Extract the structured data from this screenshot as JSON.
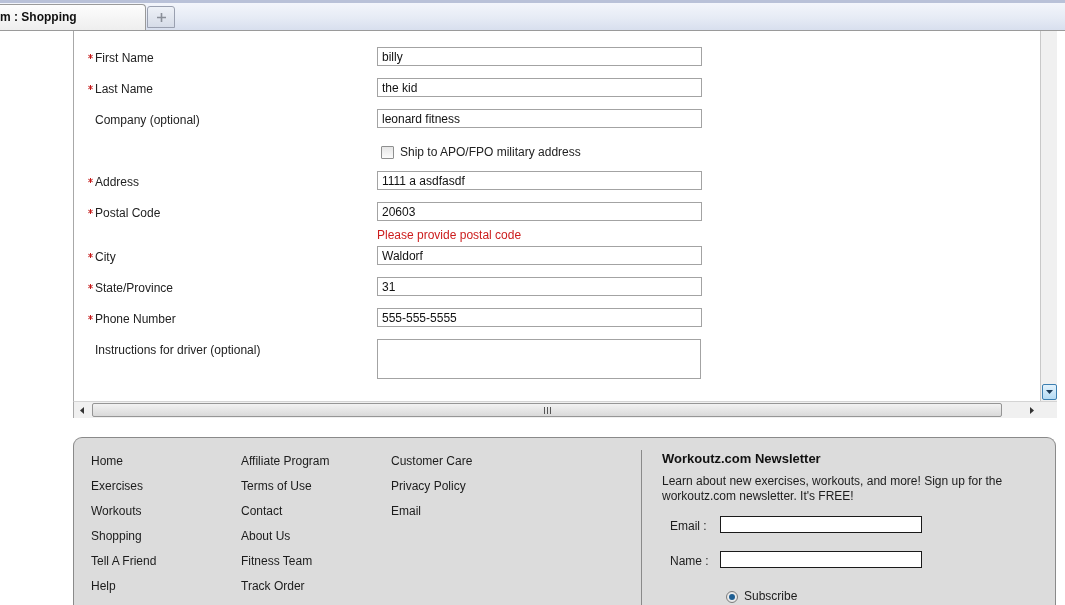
{
  "tabs": [
    {
      "title": "m : Shopping",
      "selected": true
    }
  ],
  "form": {
    "fields": [
      {
        "kind": "text",
        "label": "First Name",
        "required": true,
        "value": "billy"
      },
      {
        "kind": "text",
        "label": "Last Name",
        "required": true,
        "value": "the kid"
      },
      {
        "kind": "text",
        "label": "Company (optional)",
        "required": false,
        "value": "leonard fitness"
      },
      {
        "kind": "checkbox",
        "label": "Ship to APO/FPO military address",
        "checked": false
      },
      {
        "kind": "text",
        "label": "Address",
        "required": true,
        "value": "1111 a asdfasdf"
      },
      {
        "kind": "text",
        "label": "Postal Code",
        "required": true,
        "value": "20603",
        "error": "Please provide postal code"
      },
      {
        "kind": "text",
        "label": "City",
        "required": true,
        "value": "Waldorf"
      },
      {
        "kind": "text",
        "label": "State/Province",
        "required": true,
        "value": "31"
      },
      {
        "kind": "text",
        "label": "Phone Number",
        "required": true,
        "value": "555-555-5555"
      },
      {
        "kind": "textarea",
        "label": "Instructions for driver (optional)",
        "required": false
      }
    ]
  },
  "footer": {
    "link_columns": [
      [
        "Home",
        "Exercises",
        "Workouts",
        "Shopping",
        "Tell A Friend",
        "Help"
      ],
      [
        "Affiliate Program",
        "Terms of Use",
        "Contact",
        "About Us",
        "Fitness Team",
        "Track Order"
      ],
      [
        "Customer Care",
        "Privacy Policy",
        "Email"
      ]
    ],
    "newsletter": {
      "title": "Workoutz.com Newsletter",
      "text": "Learn about new exercises, workouts, and more! Sign up for the workoutz.com newsletter. It's FREE!",
      "fields": [
        {
          "label": "Email :"
        },
        {
          "label": "Name :"
        }
      ],
      "options": [
        {
          "label": "Subscribe",
          "selected": true
        }
      ]
    }
  }
}
